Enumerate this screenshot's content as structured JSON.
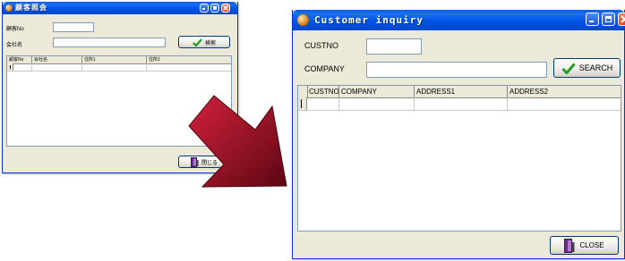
{
  "colors": {
    "arrow_light": "#d4213c",
    "arrow_dark": "#5c0713",
    "titlebar": "#0055e5",
    "window_face": "#ece9d8"
  },
  "small_window": {
    "title": "顧客照会",
    "labels": {
      "custno": "顧客No",
      "company": "会社名"
    },
    "search_label": "検索",
    "columns": [
      "顧客No",
      "会社名",
      "住所1",
      "住所2"
    ],
    "close_label": "閉じる"
  },
  "large_window": {
    "title": "Customer inquiry",
    "labels": {
      "custno": "CUSTNO",
      "company": "COMPANY"
    },
    "custno_value": "",
    "company_value": "",
    "search_label": "SEARCH",
    "columns": [
      "CUSTNO",
      "COMPANY",
      "ADDRESS1",
      "ADDRESS2"
    ],
    "close_label": "CLOSE"
  }
}
